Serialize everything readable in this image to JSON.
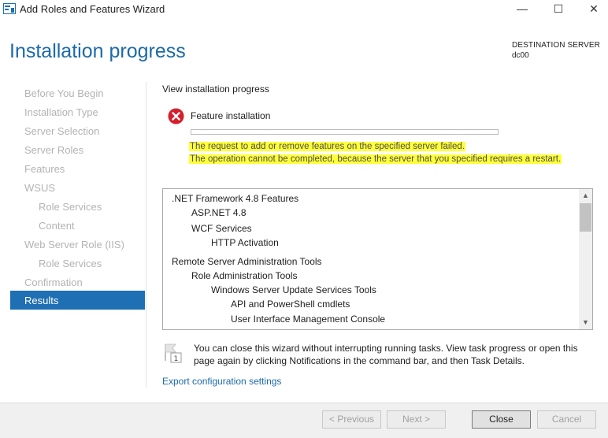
{
  "window": {
    "title": "Add Roles and Features Wizard",
    "minimize": "—",
    "maximize": "☐",
    "close": "✕"
  },
  "header": {
    "page_title": "Installation progress",
    "destination_label": "DESTINATION SERVER",
    "destination_value": "dc00"
  },
  "nav": {
    "items": [
      {
        "label": "Before You Begin"
      },
      {
        "label": "Installation Type"
      },
      {
        "label": "Server Selection"
      },
      {
        "label": "Server Roles"
      },
      {
        "label": "Features"
      },
      {
        "label": "WSUS"
      },
      {
        "label": "Role Services"
      },
      {
        "label": "Content"
      },
      {
        "label": "Web Server Role (IIS)"
      },
      {
        "label": "Role Services"
      },
      {
        "label": "Confirmation"
      },
      {
        "label": "Results"
      }
    ]
  },
  "main": {
    "section_heading": "View installation progress",
    "feature_label": "Feature installation",
    "progress_fraction": 0,
    "error_line1": "The request to add or remove features on the specified server failed.",
    "error_line2": "The operation cannot be completed, because the server that you specified requires a restart.",
    "features": [
      {
        "label": ".NET Framework 4.8 Features"
      },
      {
        "label": "ASP.NET 4.8"
      },
      {
        "label": "WCF Services"
      },
      {
        "label": "HTTP Activation"
      },
      {
        "label": "Remote Server Administration Tools"
      },
      {
        "label": "Role Administration Tools"
      },
      {
        "label": "Windows Server Update Services Tools"
      },
      {
        "label": "API and PowerShell cmdlets"
      },
      {
        "label": "User Interface Management Console"
      }
    ],
    "info_text": "You can close this wizard without interrupting running tasks. View task progress or open this page again by clicking Notifications in the command bar, and then Task Details.",
    "info_badge": "1",
    "export_link": "Export configuration settings"
  },
  "footer": {
    "previous": "< Previous",
    "next": "Next >",
    "close": "Close",
    "cancel": "Cancel"
  },
  "icons": {
    "app": "server-manager-icon",
    "error": "error-icon",
    "info": "flag-notification-icon"
  },
  "colors": {
    "accent": "#1c6aa8",
    "nav_selected": "#1e6fb3",
    "error_red": "#d4202c",
    "highlight": "#ffff3a"
  }
}
